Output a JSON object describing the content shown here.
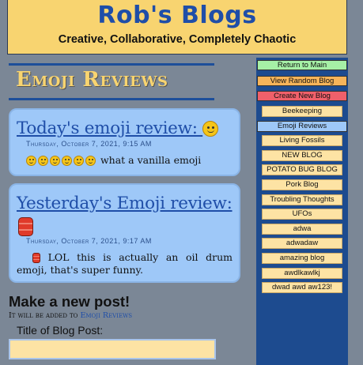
{
  "header": {
    "title": "Rob's Blogs",
    "subtitle": "Creative, Collaborative, Completely Chaotic"
  },
  "page": {
    "title": "Emoji Reviews"
  },
  "posts": [
    {
      "title": "Today's emoji review: ",
      "title_emoji": "smiling-face",
      "date": "Thursday, October 7, 2021, 9:15 AM",
      "body_emoji_count": 6,
      "body_emoji": "smiling-face",
      "body_text": " what a vanilla emoji"
    },
    {
      "title": "Yesterday's Emoji review:",
      "title_emoji": "oil-drum",
      "date": "Thursday, October 7, 2021, 9:17 AM",
      "body_emoji": "oil-drum",
      "body_text": " LOL this is actually an oil drum emoji, that's super funny."
    }
  ],
  "new_post": {
    "heading": "Make a new post!",
    "note_prefix": "It will be added to ",
    "note_link": "Emoji Reviews",
    "title_label": "Title of Blog Post:",
    "title_value": ""
  },
  "sidebar": {
    "actions": [
      {
        "label": "Return to Main",
        "color": "#a6f0a6"
      },
      {
        "label": "View Random Blog",
        "color": "#f6b45a"
      },
      {
        "label": "Create New Blog",
        "color": "#f0606a"
      }
    ],
    "blogs": [
      {
        "label": "Beekeeping",
        "active": false
      },
      {
        "label": "Emoji Reviews",
        "active": true
      },
      {
        "label": "Living Fossils",
        "active": false
      },
      {
        "label": "NEW BLOG",
        "active": false
      },
      {
        "label": "POTATO BUG BLOG",
        "active": false
      },
      {
        "label": "Pork Blog",
        "active": false
      },
      {
        "label": "Troubling Thoughts",
        "active": false
      },
      {
        "label": "UFOs",
        "active": false
      },
      {
        "label": "adwa",
        "active": false
      },
      {
        "label": "adwadaw",
        "active": false
      },
      {
        "label": "amazing blog",
        "active": false
      },
      {
        "label": "awdlkawlkj",
        "active": false
      },
      {
        "label": "dwad awd aw123!",
        "active": false
      }
    ]
  },
  "colors": {
    "background": "#7b8796",
    "header": "#f8d470",
    "accent_blue": "#1f4ea8",
    "post_card": "#9ec8f8",
    "sidebar": "#1d4b8f",
    "blog_button": "#fde3a4"
  }
}
